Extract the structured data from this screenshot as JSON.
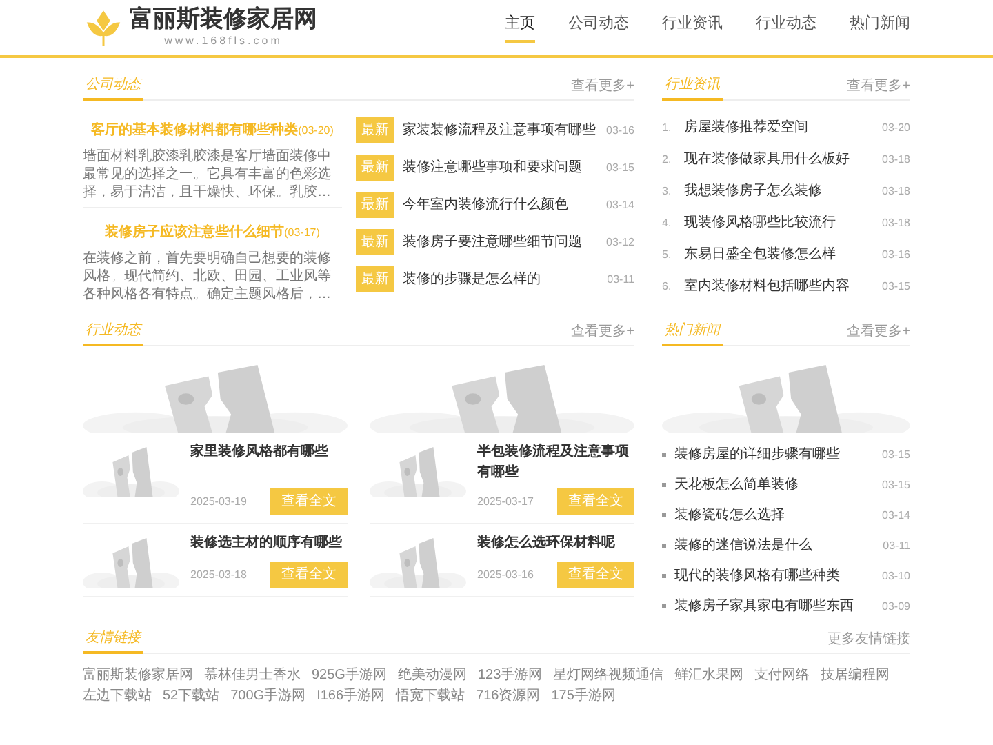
{
  "header": {
    "logo_title": "富丽斯装修家居网",
    "logo_url": "www.168fls.com",
    "nav": [
      {
        "label": "主页",
        "selected": true
      },
      {
        "label": "公司动态",
        "selected": false
      },
      {
        "label": "行业资讯",
        "selected": false
      },
      {
        "label": "行业动态",
        "selected": false
      },
      {
        "label": "热门新闻",
        "selected": false
      }
    ]
  },
  "company_news": {
    "title": "公司动态",
    "more": "查看更多+",
    "featured": [
      {
        "title": "客厅的基本装修材料都有哪些种类",
        "date": "(03-20)",
        "summary": "墙面材料乳胶漆乳胶漆是客厅墙面装修中最常见的选择之一。它具有丰富的色彩选择，易于清洁，且干燥快、环保。乳胶…"
      },
      {
        "title": "装修房子应该注意些什么细节",
        "date": "(03-17)",
        "summary": "在装修之前，首先要明确自己想要的装修风格。现代简约、北欧、田园、工业风等各种风格各有特点。确定主题风格后，…"
      }
    ],
    "list": [
      {
        "badge": "最新",
        "title": "家装装修流程及注意事项有哪些",
        "date": "03-16"
      },
      {
        "badge": "最新",
        "title": "装修注意哪些事项和要求问题",
        "date": "03-15"
      },
      {
        "badge": "最新",
        "title": "今年室内装修流行什么颜色",
        "date": "03-14"
      },
      {
        "badge": "最新",
        "title": "装修房子要注意哪些细节问题",
        "date": "03-12"
      },
      {
        "badge": "最新",
        "title": "装修的步骤是怎么样的",
        "date": "03-11"
      }
    ]
  },
  "industry_info": {
    "title": "行业资讯",
    "more": "查看更多+",
    "items": [
      {
        "number": "1.",
        "title": "房屋装修推荐爱空间",
        "date": "03-20"
      },
      {
        "number": "2.",
        "title": "现在装修做家具用什么板好",
        "date": "03-18"
      },
      {
        "number": "3.",
        "title": "我想装修房子怎么装修",
        "date": "03-18"
      },
      {
        "number": "4.",
        "title": "现装修风格哪些比较流行",
        "date": "03-18"
      },
      {
        "number": "5.",
        "title": "东易日盛全包装修怎么样",
        "date": "03-16"
      },
      {
        "number": "6.",
        "title": "室内装修材料包括哪些内容",
        "date": "03-15"
      }
    ]
  },
  "industry_dynamics": {
    "title": "行业动态",
    "more": "查看更多+",
    "cards": [
      {
        "title": "家里装修风格都有哪些",
        "date": "2025-03-19",
        "button": "查看全文"
      },
      {
        "title": "半包装修流程及注意事项有哪些",
        "date": "2025-03-17",
        "button": "查看全文"
      },
      {
        "title": "装修选主材的顺序有哪些",
        "date": "2025-03-18",
        "button": "查看全文"
      },
      {
        "title": "装修怎么选环保材料呢",
        "date": "2025-03-16",
        "button": "查看全文"
      }
    ]
  },
  "hot_news": {
    "title": "热门新闻",
    "more": "查看更多+",
    "items": [
      {
        "title": "装修房屋的详细步骤有哪些",
        "date": "03-15"
      },
      {
        "title": "天花板怎么简单装修",
        "date": "03-15"
      },
      {
        "title": "装修瓷砖怎么选择",
        "date": "03-14"
      },
      {
        "title": "装修的迷信说法是什么",
        "date": "03-11"
      },
      {
        "title": "现代的装修风格有哪些种类",
        "date": "03-10"
      },
      {
        "title": "装修房子家具家电有哪些东西",
        "date": "03-09"
      }
    ]
  },
  "links": {
    "title": "友情链接",
    "more": "更多友情链接",
    "items": [
      "富丽斯装修家居网",
      "慕林佳男士香水",
      "925G手游网",
      "绝美动漫网",
      "123手游网",
      "星灯网络视频通信",
      "鲜汇水果网",
      "支付网络",
      "技居编程网",
      "左边下载站",
      "52下载站",
      "700G手游网",
      "I166手游网",
      "悟宽下载站",
      "716资源网",
      "175手游网"
    ]
  }
}
